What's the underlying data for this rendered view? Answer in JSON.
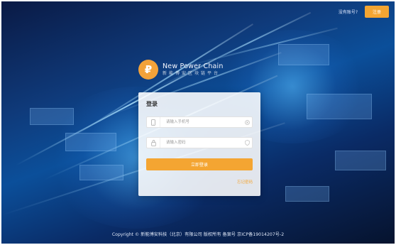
{
  "header": {
    "no_account_text": "没有账号?",
    "register_label": "注册"
  },
  "brand": {
    "name_en": "New Power Chain",
    "name_cn": "新能博安区块链平台"
  },
  "login": {
    "title": "登录",
    "phone_placeholder": "请输入手机号",
    "password_placeholder": "请输入密码",
    "submit_label": "立即登录",
    "forgot_label": "忘记密码"
  },
  "footer": {
    "text": "Copyright © 新能博安科技（北京）有限公司 版权所有 备案号 京ICP备19014207号-2"
  },
  "colors": {
    "accent": "#f4a532",
    "background": "#0b4f9a"
  },
  "icons": {
    "phone": "phone-icon",
    "lock": "lock-icon",
    "clear": "clear-icon",
    "shield": "shield-icon",
    "logo": "power-chain-logo-icon"
  }
}
